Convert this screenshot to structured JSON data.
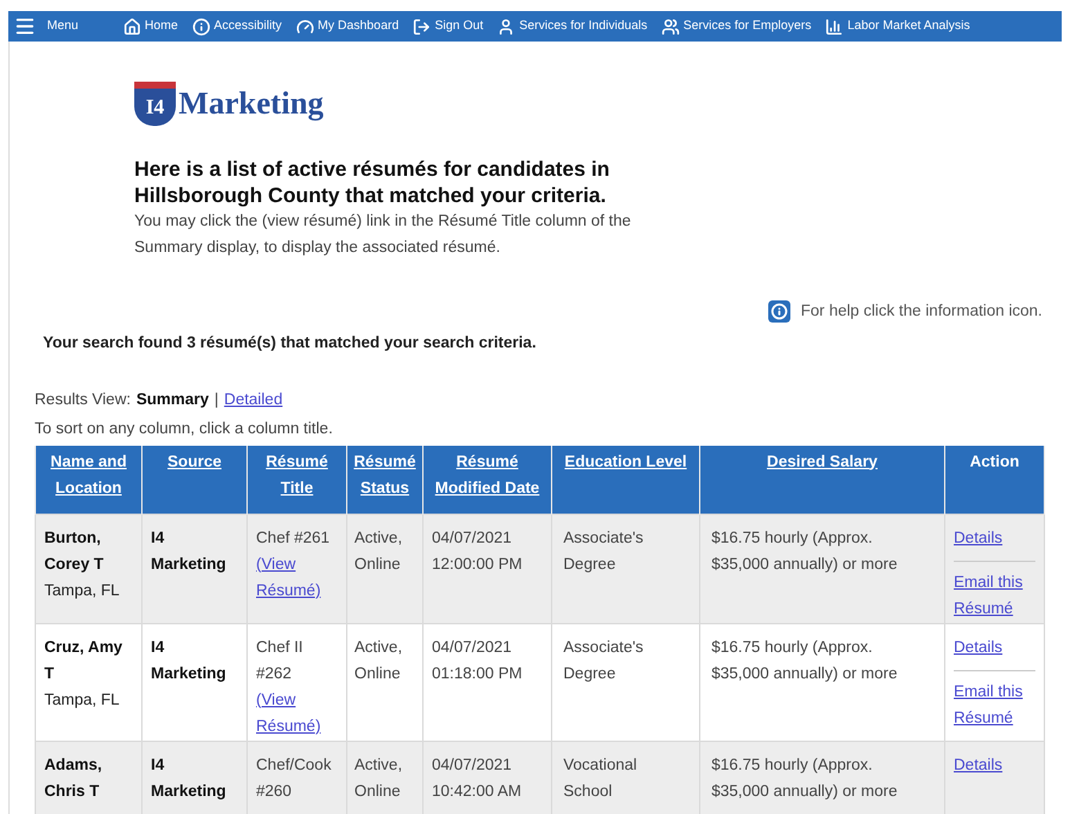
{
  "nav": [
    {
      "kind": "menu",
      "label": "Menu"
    },
    {
      "kind": "home",
      "label": "Home"
    },
    {
      "kind": "accessibility",
      "label": "Accessibility"
    },
    {
      "kind": "dashboard",
      "label": "My Dashboard"
    },
    {
      "kind": "signout",
      "label": "Sign Out"
    },
    {
      "kind": "individuals",
      "label": "Services for Individuals"
    },
    {
      "kind": "employers",
      "label": "Services for Employers"
    },
    {
      "kind": "labor",
      "label": "Labor Market Analysis"
    }
  ],
  "logo": {
    "badge": "I4",
    "name": "Marketing"
  },
  "heading": "Here is a list of active résumés for candidates in Hillsborough County that matched your criteria.",
  "intro": "You may click the (view résumé) link in the Résumé Title column of the Summary display, to display the associated résumé.",
  "help": "For help click the information icon.",
  "found": "Your search found 3 résumé(s) that matched your search criteria.",
  "results_view": {
    "label": "Results View:",
    "options": [
      {
        "label": "Summary",
        "selected": true
      },
      {
        "label": "Detailed",
        "selected": false
      }
    ],
    "separator": "|"
  },
  "sort_hint": "To sort on any column, click a column title.",
  "table": {
    "columns": [
      {
        "label": "Name and Location",
        "sortable": true
      },
      {
        "label": "Source",
        "sortable": true
      },
      {
        "label": "Résumé Title",
        "sortable": true
      },
      {
        "label": "Résumé Status",
        "sortable": true
      },
      {
        "label": "Résumé Modified Date",
        "sortable": true
      },
      {
        "label": "Education Level",
        "sortable": true
      },
      {
        "label": "Desired Salary",
        "sortable": true
      },
      {
        "label": "Action",
        "sortable": false
      }
    ],
    "rows": [
      {
        "name": "Burton, Corey T",
        "location": "Tampa, FL",
        "source": "I4 Marketing",
        "title": "Chef #261",
        "view_link": "(View Résumé)",
        "status": "Active, Online",
        "modified": "04/07/2021 12:00:00 PM",
        "education": "Associate's Degree",
        "salary": "$16.75 hourly (Approx. $35,000 annually) or more",
        "actions": [
          "Details",
          "Email this Résumé"
        ]
      },
      {
        "name": "Cruz, Amy T",
        "location": "Tampa, FL",
        "source": "I4 Marketing",
        "title": "Chef II #262",
        "view_link": "(View Résumé)",
        "status": "Active, Online",
        "modified": "04/07/2021 01:18:00 PM",
        "education": "Associate's Degree",
        "salary": "$16.75 hourly (Approx. $35,000 annually) or more",
        "actions": [
          "Details",
          "Email this Résumé"
        ]
      },
      {
        "name": "Adams, Chris T",
        "source": "I4 Marketing",
        "title": "Chef/Cook #260",
        "status": "Active, Online",
        "modified": "04/07/2021 10:42:00 AM",
        "education": "Vocational School",
        "salary": "$16.75 hourly (Approx. $35,000 annually) or more",
        "actions": [
          "Details"
        ]
      }
    ]
  }
}
